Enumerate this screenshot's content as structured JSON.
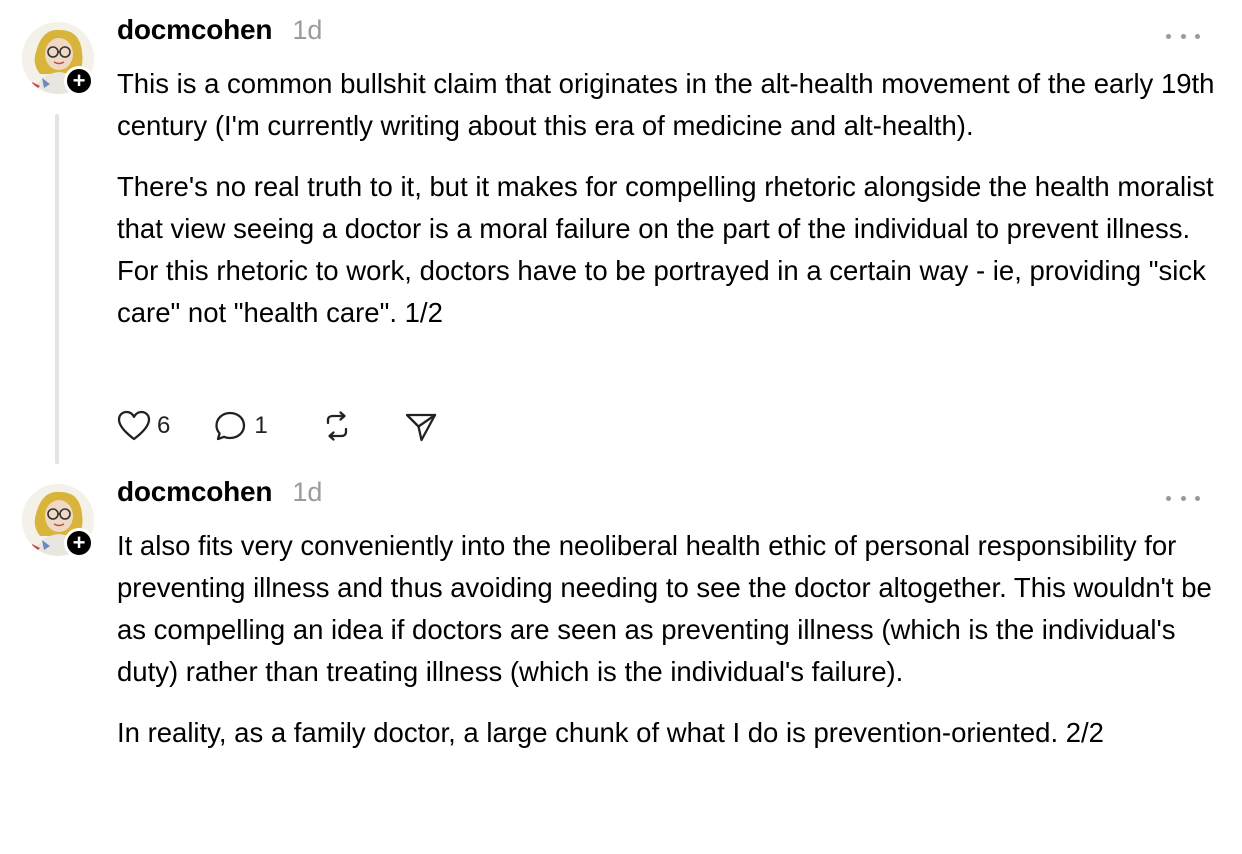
{
  "posts": [
    {
      "username": "docmcohen",
      "time": "1d",
      "paragraphs": [
        "This is a common bullshit claim that originates in the alt-health movement of the early 19th century (I'm currently writing about this era of medicine and alt-health).",
        "There's no real truth to it, but it makes for compelling rhetoric alongside the health moralist that view seeing a doctor is a moral failure on the part of the individual to prevent illness. For this rhetoric to work, doctors have to be portrayed in a certain way - ie, providing \"sick care\" not \"health care\". 1/2"
      ],
      "likes": "6",
      "replies": "1",
      "icons": [
        "heart-icon",
        "comment-icon",
        "repost-icon",
        "send-icon",
        "more-icon",
        "plus-icon"
      ]
    },
    {
      "username": "docmcohen",
      "time": "1d",
      "paragraphs": [
        "It also fits very conveniently into the neoliberal health ethic of personal responsibility for preventing illness and thus avoiding needing to see the doctor altogether. This wouldn't be as compelling an idea if doctors are seen as preventing illness (which is the individual's duty) rather than treating illness (which is the individual's failure).",
        "In reality, as a family doctor, a large chunk of what I do is prevention-oriented. 2/2"
      ]
    }
  ],
  "colors": {
    "text": "#000000",
    "muted": "#9b9b9b",
    "thread_line": "#e3e3e3",
    "badge": "#000000"
  }
}
